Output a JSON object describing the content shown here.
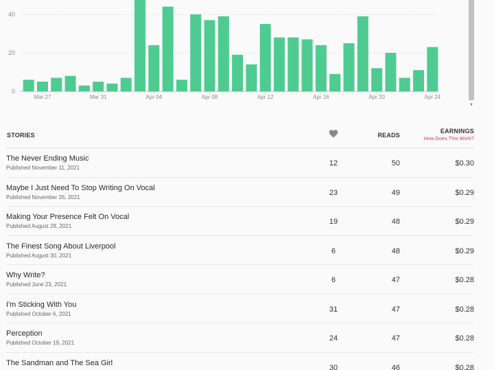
{
  "chart_data": {
    "type": "bar",
    "y_ticks": [
      "0",
      "20",
      "40"
    ],
    "ylim": [
      0,
      48
    ],
    "x_ticks": [
      {
        "index": 1,
        "label": "Mar 27"
      },
      {
        "index": 5,
        "label": "Mar 31"
      },
      {
        "index": 9,
        "label": "Apr 04"
      },
      {
        "index": 13,
        "label": "Apr 08"
      },
      {
        "index": 17,
        "label": "Apr 12"
      },
      {
        "index": 21,
        "label": "Apr 16"
      },
      {
        "index": 25,
        "label": "Apr 20"
      },
      {
        "index": 29,
        "label": "Apr 24"
      }
    ],
    "categories": [
      "Mar 26",
      "Mar 27",
      "Mar 28",
      "Mar 29",
      "Mar 30",
      "Mar 31",
      "Apr 01",
      "Apr 02",
      "Apr 03",
      "Apr 04",
      "Apr 05",
      "Apr 06",
      "Apr 07",
      "Apr 08",
      "Apr 09",
      "Apr 10",
      "Apr 11",
      "Apr 12",
      "Apr 13",
      "Apr 14",
      "Apr 15",
      "Apr 16",
      "Apr 17",
      "Apr 18",
      "Apr 19",
      "Apr 20",
      "Apr 21",
      "Apr 22",
      "Apr 23",
      "Apr 24"
    ],
    "values": [
      6,
      5,
      7,
      8,
      3,
      5,
      4,
      7,
      48,
      24,
      44,
      6,
      40,
      37,
      39,
      19,
      14,
      35,
      28,
      28,
      27,
      24,
      9,
      25,
      39,
      12,
      20,
      7,
      11,
      23
    ],
    "color": "#4ecb91",
    "grid": true
  },
  "table": {
    "headers": {
      "stories": "STORIES",
      "likes_icon": "heart-icon",
      "reads": "READS",
      "earnings": "EARNINGS",
      "how_link": "How Does This Work?"
    },
    "rows": [
      {
        "title": "The Never Ending Music",
        "published": "Published November 11, 2021",
        "likes": "12",
        "reads": "50",
        "earnings": "$0.30"
      },
      {
        "title": "Maybe I Just Need To Stop Writing On Vocal",
        "published": "Published November 26, 2021",
        "likes": "23",
        "reads": "49",
        "earnings": "$0.29"
      },
      {
        "title": "Making Your Presence Felt On Vocal",
        "published": "Published August 28, 2021",
        "likes": "19",
        "reads": "48",
        "earnings": "$0.29"
      },
      {
        "title": "The Finest Song About Liverpool",
        "published": "Published August 30, 2021",
        "likes": "6",
        "reads": "48",
        "earnings": "$0.29"
      },
      {
        "title": "Why Write?",
        "published": "Published June 23, 2021",
        "likes": "6",
        "reads": "47",
        "earnings": "$0.28"
      },
      {
        "title": "I'm Sticking With You",
        "published": "Published October 6, 2021",
        "likes": "31",
        "reads": "47",
        "earnings": "$0.28"
      },
      {
        "title": "Perception",
        "published": "Published October 19, 2021",
        "likes": "24",
        "reads": "47",
        "earnings": "$0.28"
      },
      {
        "title": "The Sandman and The Sea Girl",
        "published": "",
        "likes": "30",
        "reads": "46",
        "earnings": "$0.28"
      }
    ]
  }
}
